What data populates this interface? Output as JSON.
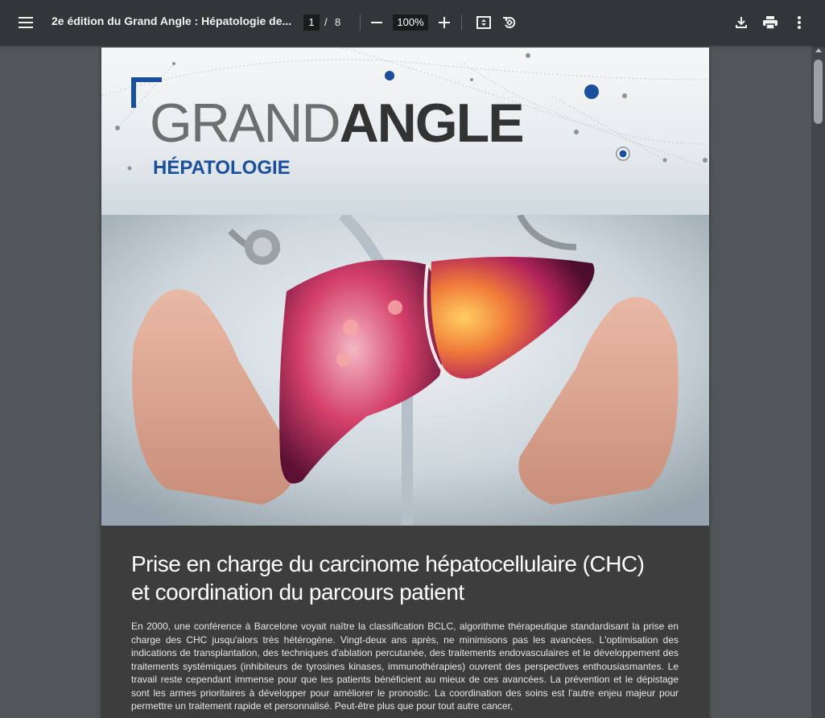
{
  "toolbar": {
    "document_title": "2e édition du Grand Angle : Hépatologie de...",
    "current_page": "1",
    "page_separator": "/",
    "total_pages": "8",
    "zoom_level": "100%"
  },
  "icons": {
    "menu": "hamburger-menu-icon",
    "zoom_out": "minus-icon",
    "zoom_in": "plus-icon",
    "fit": "fit-to-page-icon",
    "rotate": "rotate-counterclockwise-icon",
    "download": "download-icon",
    "print": "printer-icon",
    "more": "more-vertical-icon"
  },
  "document": {
    "logo_light": "GRAND",
    "logo_bold": "ANGLE",
    "logo_subtitle": "HÉPATOLOGIE",
    "headline_line1": "Prise en charge du carcinome hépatocellulaire (CHC)",
    "headline_line2": "et coordination du parcours patient",
    "body_text": "En 2000, une conférence à Barcelone voyait naître la classification BCLC, algorithme thérapeutique standardisant la prise en charge des CHC jusqu'alors très hétérogène. Vingt-deux ans après, ne minimisons pas les avancées. L'optimisation des indications de transplantation, des techniques d'ablation percutanée, des traitements endovasculaires et le développement des traitements systémiques (inhibiteurs de tyrosines kinases, immunothérapies) ouvrent des perspectives enthousiasmantes. Le travail reste cependant immense pour que les patients bénéficient au mieux de ces avancées. La prévention et le dépistage sont les armes prioritaires à développer pour améliorer le pronostic. La coordination des soins est l'autre enjeu majeur pour permettre un traitement rapide et personnalisé. Peut-être plus que pour tout autre cancer,"
  },
  "colors": {
    "toolbar_bg": "#323639",
    "viewer_bg": "#525659",
    "brand_blue": "#1a4f9c",
    "article_bg": "#3d3d3d"
  }
}
